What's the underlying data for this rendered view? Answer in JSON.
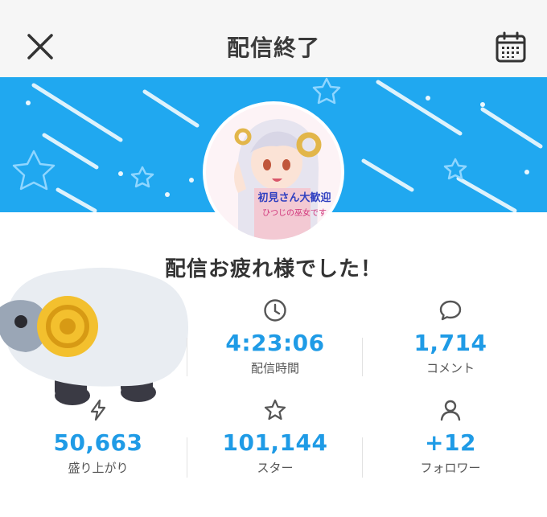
{
  "header": {
    "title": "配信終了",
    "close_icon": "close-icon",
    "calendar_icon": "calendar-icon"
  },
  "banner": {
    "color": "#20a8f0"
  },
  "avatar": {
    "banner_text": "初見さん大歓迎",
    "sub_text": "ひつじの巫女です"
  },
  "thanks_message": "配信お疲れ様でした！",
  "stats": {
    "duration": {
      "value": "4:23:06",
      "label": "配信時間",
      "icon": "clock-icon"
    },
    "comments": {
      "value": "1,714",
      "label": "コメント",
      "icon": "speech-bubble-icon"
    },
    "hype": {
      "value": "50,663",
      "label": "盛り上がり",
      "icon": "lightning-icon"
    },
    "stars": {
      "value": "101,144",
      "label": "スター",
      "icon": "star-icon"
    },
    "followers": {
      "value": "+12",
      "label": "フォロワー",
      "icon": "person-icon"
    }
  },
  "accent_color": "#1f9be6"
}
